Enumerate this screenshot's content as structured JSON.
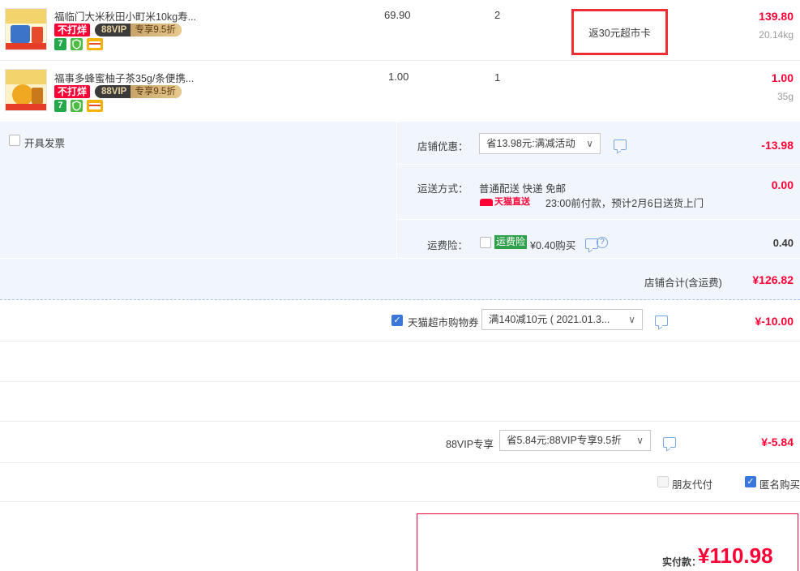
{
  "items": [
    {
      "title": "福临门大米秋田小町米10kg寿...",
      "tags": {
        "no_discount": "不打烊",
        "vip_left": "88VIP",
        "vip_right": "专享9.5折"
      },
      "service_icons": [
        "7",
        "shield-icon",
        "card-icon"
      ],
      "unit_price": "69.90",
      "quantity": "2",
      "promo": "返30元超市卡",
      "subtotal": "139.80",
      "weight": "20.14kg"
    },
    {
      "title": "福事多蜂蜜柚子茶35g/条便携...",
      "tags": {
        "no_discount": "不打烊",
        "vip_left": "88VIP",
        "vip_right": "专享9.5折"
      },
      "service_icons": [
        "7",
        "shield-icon",
        "card-icon"
      ],
      "unit_price": "1.00",
      "quantity": "1",
      "subtotal": "1.00",
      "weight": "35g"
    }
  ],
  "invoice": {
    "label": "开具发票"
  },
  "store_discount": {
    "label": "店铺优惠：",
    "selected": "省13.98元:满减活动",
    "amount": "-13.98"
  },
  "shipping": {
    "label": "运送方式：",
    "method": "普通配送 快递 免邮",
    "badge": "天猫直送",
    "delivery_note": "23:00前付款，预计2月6日送货上门",
    "amount": "0.00"
  },
  "insurance": {
    "label": "运费险：",
    "tag": "运费险",
    "price_text": "¥0.40购买",
    "amount": "0.40"
  },
  "store_total": {
    "label": "店铺合计(含运费)",
    "amount": "¥126.82"
  },
  "coupon": {
    "label": "天猫超市购物券",
    "selected": "满140减10元 ( 2021.01.3...",
    "amount": "¥-10.00"
  },
  "vip": {
    "label": "88VIP专享",
    "selected": "省5.84元:88VIP专享9.5折",
    "amount": "¥-5.84"
  },
  "options": {
    "friend_pay": "朋友代付",
    "anonymous": "匿名购买"
  },
  "pay": {
    "label": "实付款：",
    "amount": "¥110.98"
  },
  "colors": {
    "accent_red": "#ff0036",
    "highlight_border": "#ee2d36",
    "panel_bg": "#f1f6fd",
    "checkbox_blue": "#3a76dc"
  }
}
